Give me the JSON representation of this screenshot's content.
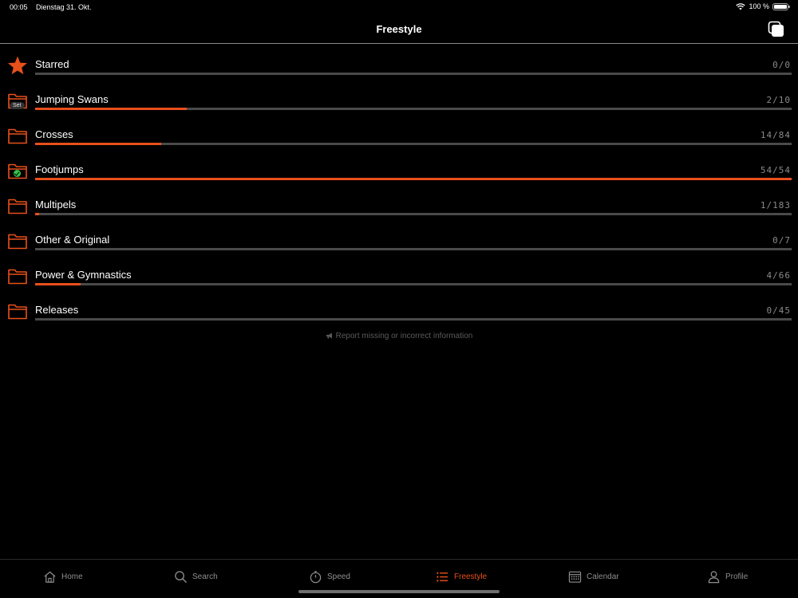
{
  "status_bar": {
    "time": "00:05",
    "date": "Dienstag 31. Okt.",
    "battery": "100 %"
  },
  "nav": {
    "title": "Freestyle"
  },
  "categories": [
    {
      "label": "Starred",
      "count": "0/0",
      "progress": 0,
      "icon": "star-icon"
    },
    {
      "label": "Jumping Swans",
      "count": "2/10",
      "progress": 0.2,
      "icon": "folder-icon",
      "badge": "Set"
    },
    {
      "label": "Crosses",
      "count": "14/84",
      "progress": 0.1667,
      "icon": "folder-icon"
    },
    {
      "label": "Footjumps",
      "count": "54/54",
      "progress": 1.0,
      "icon": "folder-check-icon"
    },
    {
      "label": "Multipels",
      "count": "1/183",
      "progress": 0.0055,
      "icon": "folder-icon"
    },
    {
      "label": "Other & Original",
      "count": "0/7",
      "progress": 0,
      "icon": "folder-icon"
    },
    {
      "label": "Power & Gymnastics",
      "count": "4/66",
      "progress": 0.0606,
      "icon": "folder-icon"
    },
    {
      "label": "Releases",
      "count": "0/45",
      "progress": 0,
      "icon": "folder-icon"
    }
  ],
  "report_link": "Report missing or incorrect information",
  "tabs": [
    {
      "label": "Home",
      "icon": "home-icon",
      "active": false
    },
    {
      "label": "Search",
      "icon": "search-icon",
      "active": false
    },
    {
      "label": "Speed",
      "icon": "stopwatch-icon",
      "active": false
    },
    {
      "label": "Freestyle",
      "icon": "list-icon",
      "active": true
    },
    {
      "label": "Calendar",
      "icon": "calendar-icon",
      "active": false
    },
    {
      "label": "Profile",
      "icon": "person-icon",
      "active": false
    }
  ],
  "colors": {
    "accent": "#e8501a",
    "track": "#4a4a4a",
    "check": "#35c24a",
    "background": "#000000"
  }
}
